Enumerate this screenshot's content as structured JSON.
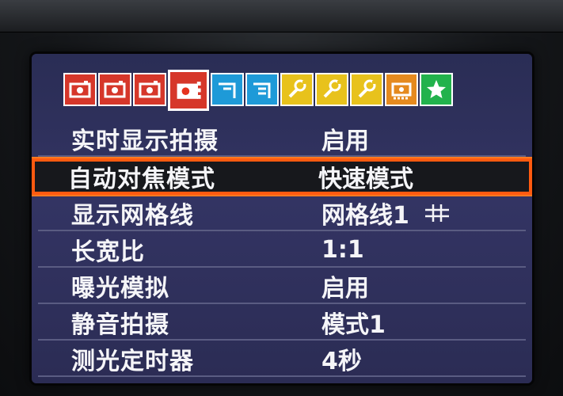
{
  "tabs": [
    {
      "name": "shooting-tab-1",
      "color": "red",
      "icon": "camera-icon"
    },
    {
      "name": "shooting-tab-2",
      "color": "red",
      "icon": "camera-icon"
    },
    {
      "name": "shooting-tab-3",
      "color": "red",
      "icon": "camera-icon"
    },
    {
      "name": "shooting-tab-4",
      "color": "red",
      "icon": "camera-icon",
      "active": true
    },
    {
      "name": "playback-tab-1",
      "color": "blue",
      "icon": "playback-icon"
    },
    {
      "name": "playback-tab-2",
      "color": "blue",
      "icon": "playback-icon"
    },
    {
      "name": "setup-tab-1",
      "color": "yellow",
      "icon": "wrench-icon"
    },
    {
      "name": "setup-tab-2",
      "color": "yellow",
      "icon": "wrench-icon"
    },
    {
      "name": "setup-tab-3",
      "color": "yellow",
      "icon": "wrench-icon"
    },
    {
      "name": "custom-functions-tab",
      "color": "orange",
      "icon": "custom-camera-icon"
    },
    {
      "name": "my-menu-tab",
      "color": "green",
      "icon": "star-icon"
    }
  ],
  "menu": {
    "items": [
      {
        "label": "实时显示拍摄",
        "value": "启用"
      },
      {
        "label": "自动对焦模式",
        "value": "快速模式",
        "selected": true
      },
      {
        "label": "显示网格线",
        "value": "网格线1",
        "glyph": "grid-icon"
      },
      {
        "label": "长宽比",
        "value": "1:1"
      },
      {
        "label": "曝光模拟",
        "value": "启用"
      },
      {
        "label": "静音拍摄",
        "value": "模式1"
      },
      {
        "label": "测光定时器",
        "value": "4秒"
      }
    ]
  },
  "colors": {
    "selection": "#ff5a10",
    "menu_bg": "#2e3060",
    "text": "#f5f5f8"
  }
}
